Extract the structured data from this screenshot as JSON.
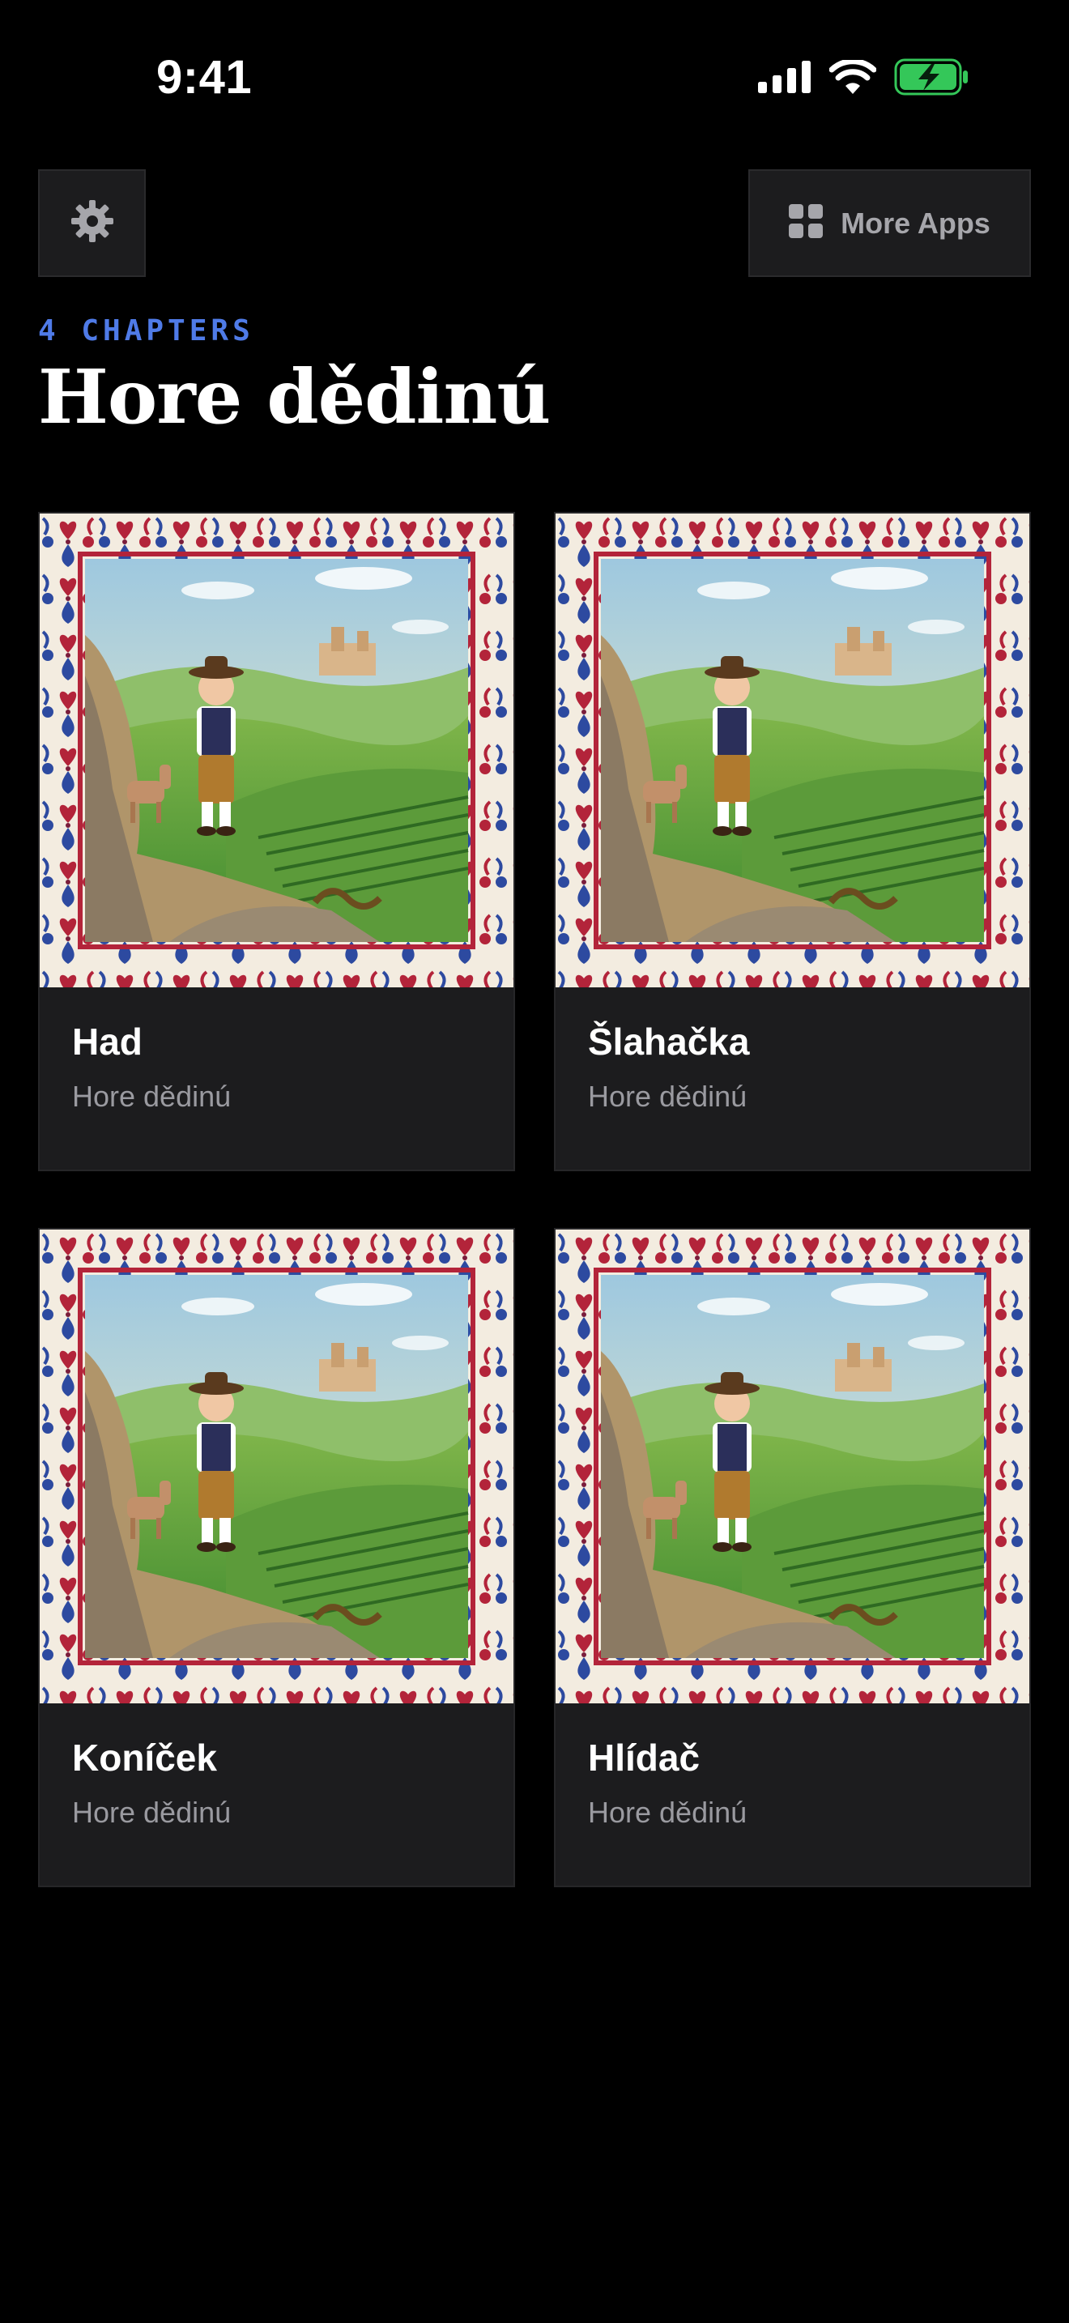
{
  "status_bar": {
    "time": "9:41",
    "icons": [
      "cellular-signal-icon",
      "wifi-icon",
      "battery-charging-icon"
    ],
    "battery_color": "#34c759"
  },
  "toolbar": {
    "settings_icon": "gear-icon",
    "more_apps_icon": "grid-icon",
    "more_apps_label": "More Apps"
  },
  "header": {
    "chapters_count": "4 CHAPTERS",
    "title": "Hore dědinú",
    "accent_color": "#4f7be8"
  },
  "chapters": [
    {
      "title": "Had",
      "subtitle": "Hore dědinú"
    },
    {
      "title": "Šlahačka",
      "subtitle": "Hore dědinú"
    },
    {
      "title": "Koníček",
      "subtitle": "Hore dědinú"
    },
    {
      "title": "Hlídač",
      "subtitle": "Hore dědinú"
    }
  ]
}
